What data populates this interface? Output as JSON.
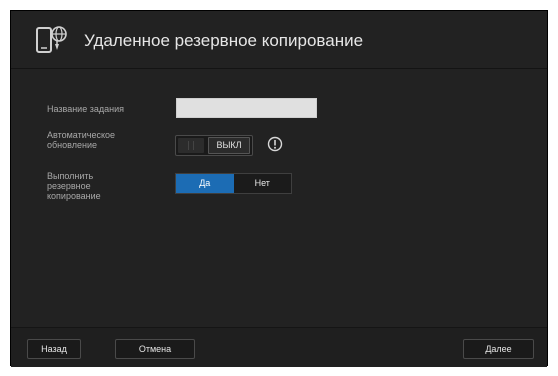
{
  "header": {
    "title": "Удаленное резервное копирование",
    "icon": "cloud-device-icon"
  },
  "form": {
    "task_name_label": "Название задания",
    "task_name_value": "",
    "auto_update_label": "Автоматическое обновление",
    "auto_update_state": "ВЫКЛ",
    "info_icon": "info-icon",
    "run_backup_label": "Выполнить резервное копирование",
    "run_backup_options": [
      "Да",
      "Нет"
    ],
    "run_backup_selected": "Да"
  },
  "footer": {
    "back_label": "Назад",
    "cancel_label": "Отмена",
    "next_label": "Далее"
  },
  "colors": {
    "background": "#222222",
    "accent": "#1c6cb4",
    "input": "#e0e0e0"
  }
}
